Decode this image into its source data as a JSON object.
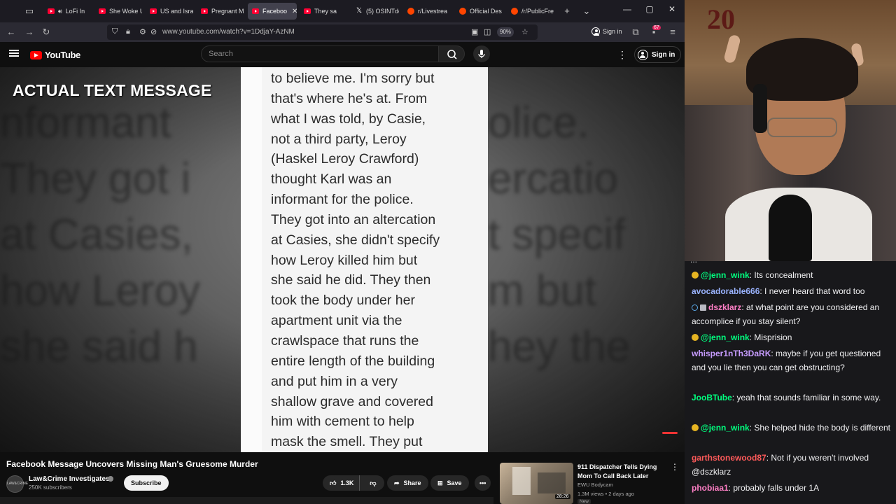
{
  "browser": {
    "tabs": [
      {
        "label": "LoFi In",
        "fav": "yt",
        "speaker": true
      },
      {
        "label": "She Woke U",
        "fav": "yt"
      },
      {
        "label": "US and Isra",
        "fav": "yt"
      },
      {
        "label": "Pregnant M",
        "fav": "yt"
      },
      {
        "label": "Faceboo",
        "fav": "yt",
        "active": true
      },
      {
        "label": "They sa",
        "fav": "yt"
      },
      {
        "label": "(5) OSINTde",
        "fav": "x"
      },
      {
        "label": "r/Livestrea",
        "fav": "reddit"
      },
      {
        "label": "Official Des",
        "fav": "reddit"
      },
      {
        "label": "/r/PublicFre",
        "fav": "reddit"
      }
    ],
    "url": "www.youtube.com/watch?v=1DdjaY-AzNM",
    "zoom": "90%",
    "signin_label": "Sign in",
    "notifications_count": "67"
  },
  "youtube": {
    "logo_text": "YouTube",
    "search_placeholder": "Search",
    "signin_label": "Sign in",
    "video": {
      "overlay_title": "ACTUAL TEXT MESSAGE",
      "message_lines": [
        "to believe me. I'm sorry but",
        "that's where he's at. From",
        "what I was told, by Casie,",
        "not a third party,  Leroy",
        "(Haskel Leroy Crawford)",
        "thought Karl was an",
        "informant for the police.",
        "They got into an altercation",
        "at Casies, she didn't specify",
        "how Leroy killed him but",
        "she said he did. They then",
        "took the body under her",
        "apartment unit via the",
        "crawlspace that runs the",
        "entire length of the building",
        "and put him in a very",
        "shallow grave and covered",
        "him with cement to help",
        "mask the smell. They put"
      ],
      "blur_left_lines": [
        "nformant",
        "They got i",
        "at Casies,",
        "how Leroy",
        "she said h"
      ],
      "blur_right_lines": [
        "olice.",
        "ercatio",
        "t specif",
        "m but",
        "hey the"
      ]
    },
    "title": "Facebook Message Uncovers Missing Man's Gruesome Murder",
    "channel": {
      "name": "Law&Crime Investigates",
      "subscribers": "250K subscribers",
      "avatar_text": "LAW&CRIME INVESTIGATES",
      "subscribe_label": "Subscribe"
    },
    "actions": {
      "likes": "1.3K",
      "share_label": "Share",
      "save_label": "Save"
    },
    "recommended": {
      "title": "911 Dispatcher Tells Dying Mom To Call Back Later",
      "channel": "EWU Bodycam",
      "meta": "1.3M views • 2 days ago",
      "badge": "New",
      "duration": "28:26"
    }
  },
  "stream": {
    "webcam_score": "20"
  },
  "chat": {
    "cut_line": "...",
    "messages": [
      {
        "user": "@jenn_wink",
        "text": ": Its concealment",
        "color": "#00ff7f",
        "badge": "gold"
      },
      {
        "user": "avocadorable666",
        "text": ": I never heard that word too",
        "color": "#9ab3ff"
      },
      {
        "user": "dszklarz",
        "text": ": at what point are you considered an accomplice if you stay silent?",
        "color": "#ff7fc6",
        "badge": "mod"
      },
      {
        "user": "@jenn_wink",
        "text": ": Misprision",
        "color": "#00ff7f",
        "badge": "gold"
      },
      {
        "user": "whisper1nTh3DaRK",
        "text": ": maybe if you get questioned and you lie then you can get obstructing?",
        "color": "#c79cff"
      },
      {
        "user": "JooBTube",
        "text": ": yeah that sounds familiar in some way.",
        "color": "#00ff7f"
      },
      {
        "user": "@jenn_wink",
        "text": ": She helped hide the body is different",
        "color": "#00ff7f",
        "badge": "gold"
      },
      {
        "user": "garthstonewood87",
        "text": ": Not if you weren't involved @dszklarz",
        "color": "#ff5a5a"
      },
      {
        "user": "phobiaa1",
        "text": ": probably falls under 1A",
        "color": "#ff7fc6"
      }
    ]
  }
}
